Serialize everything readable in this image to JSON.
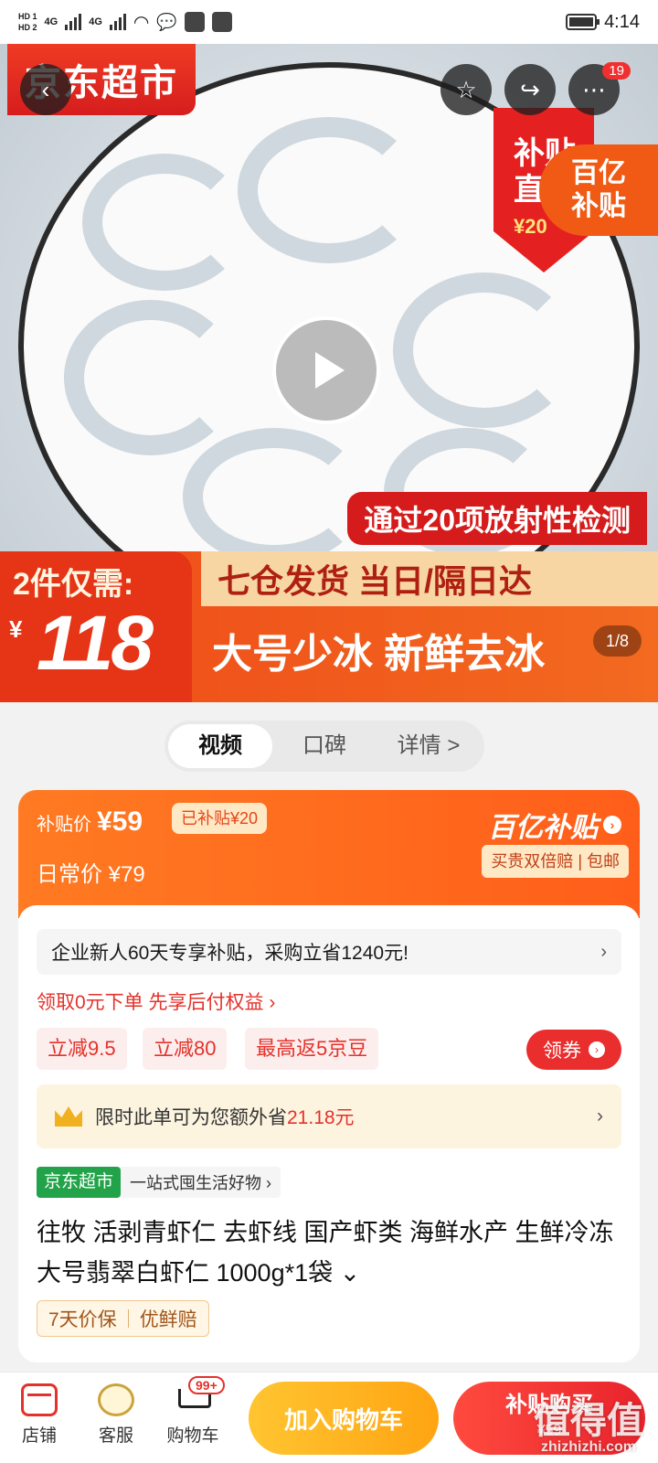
{
  "status_bar": {
    "hd1": "HD 1",
    "hd2": "HD 2",
    "net1": "4G",
    "net2": "4G",
    "time": "4:14",
    "icons": [
      "signal-icon",
      "wifi-icon",
      "wechat-icon",
      "bag-icon",
      "shield-icon",
      "battery-icon"
    ]
  },
  "hero": {
    "brand_tag": "京东超市",
    "cart_count": "19",
    "promo_red_line1": "补贴",
    "promo_red_line2": "直降",
    "promo_red_price": "¥20",
    "yi_badge_line1": "百亿",
    "yi_badge_line2": "补贴",
    "test_banner": "通过20项放射性检测",
    "price_label": "2件仅需:",
    "price_currency": "¥",
    "price_value": "118",
    "slogan1": "七仓发货 当日/隔日达",
    "slogan2": "大号少冰 新鲜去冰",
    "pager": "1/8"
  },
  "media_tabs": [
    {
      "label": "视频",
      "active": true
    },
    {
      "label": "口碑",
      "active": false
    },
    {
      "label": "详情 >",
      "active": false
    }
  ],
  "subsidy": {
    "price_label": "补贴价",
    "price_value": "¥59",
    "subsidized_tag": "已补贴¥20",
    "regular_label": "日常价",
    "regular_value": "¥79",
    "logo": "百亿补贴",
    "logo_arrow": "›",
    "guarantee": "买贵双倍赔 | 包邮"
  },
  "offers": {
    "enterprise": "企业新人60天专享补贴，采购立省1240元!",
    "enterprise_chev": "›",
    "pay_later": "领取0元下单 先享后付权益 ›",
    "coupons": [
      "立减9.5",
      "立减80",
      "最高返5京豆"
    ],
    "get_coupon": "领券",
    "save_prefix": "限时此单可为您额外省",
    "save_amount": "21.18元",
    "save_chev": "›"
  },
  "product": {
    "shop_tag": "京东超市",
    "shop_desc": "一站式囤生活好物 ›",
    "title": "往牧 活剥青虾仁 去虾线 国产虾类 海鲜水产 生鲜冷冻 大号翡翠白虾仁 1000g*1袋 ⌄",
    "tags": [
      "7天价保",
      "优鲜赔"
    ]
  },
  "bottom_bar": {
    "shop": "店铺",
    "service": "客服",
    "cart": "购物车",
    "cart_badge": "99+",
    "add_to_cart": "加入购物车",
    "buy_now": "补贴购买",
    "buy_price": "¥59"
  },
  "watermark": {
    "line1": "值得值",
    "line2": "zhizhizhi.com"
  },
  "colors": {
    "brand_red": "#e4322b",
    "subsidy_orange": "#ff6a20",
    "add_cart_yellow": "#ffb320"
  }
}
